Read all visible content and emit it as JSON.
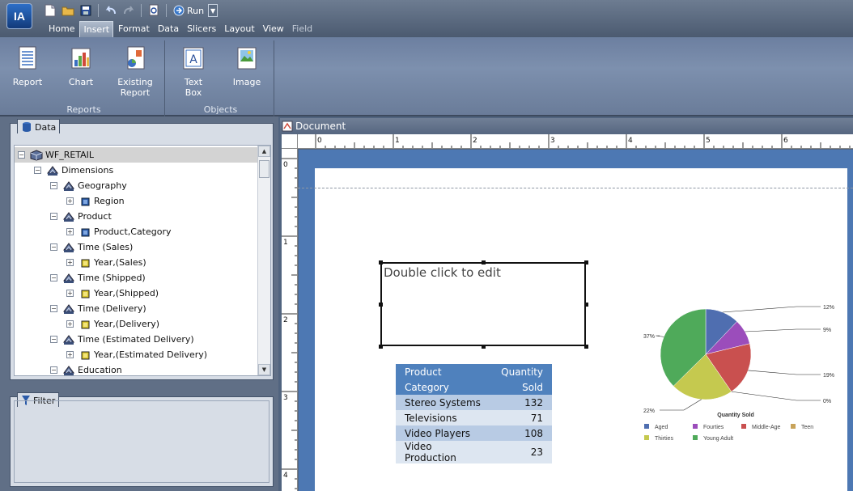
{
  "app": {
    "logo_text": "IA",
    "run_label": "Run"
  },
  "tabs": [
    {
      "label": "Home",
      "active": false,
      "enabled": true
    },
    {
      "label": "Insert",
      "active": true,
      "enabled": true
    },
    {
      "label": "Format",
      "active": false,
      "enabled": true
    },
    {
      "label": "Data",
      "active": false,
      "enabled": true
    },
    {
      "label": "Slicers",
      "active": false,
      "enabled": true
    },
    {
      "label": "Layout",
      "active": false,
      "enabled": true
    },
    {
      "label": "View",
      "active": false,
      "enabled": true
    },
    {
      "label": "Field",
      "active": false,
      "enabled": false
    }
  ],
  "ribbon": {
    "reports_group": {
      "label": "Reports",
      "report": "Report",
      "chart": "Chart",
      "existing_report_line1": "Existing",
      "existing_report_line2": "Report"
    },
    "objects_group": {
      "label": "Objects",
      "textbox_line1": "Text",
      "textbox_line2": "Box",
      "image": "Image"
    }
  },
  "data_panel": {
    "title": "Data",
    "tree": [
      {
        "label": "WF_RETAIL",
        "level": 0,
        "kind": "root",
        "expanded": true
      },
      {
        "label": "Dimensions",
        "level": 1,
        "kind": "folder",
        "expanded": true
      },
      {
        "label": "Geography",
        "level": 2,
        "kind": "folder",
        "expanded": true
      },
      {
        "label": "Region",
        "level": 3,
        "kind": "field",
        "expanded": false
      },
      {
        "label": "Product",
        "level": 2,
        "kind": "folder",
        "expanded": true
      },
      {
        "label": "Product,Category",
        "level": 3,
        "kind": "field",
        "expanded": false
      },
      {
        "label": "Time (Sales)",
        "level": 2,
        "kind": "folder",
        "expanded": true
      },
      {
        "label": "Year,(Sales)",
        "level": 3,
        "kind": "date",
        "expanded": false
      },
      {
        "label": "Time (Shipped)",
        "level": 2,
        "kind": "folder",
        "expanded": true
      },
      {
        "label": "Year,(Shipped)",
        "level": 3,
        "kind": "date",
        "expanded": false
      },
      {
        "label": "Time (Delivery)",
        "level": 2,
        "kind": "folder",
        "expanded": true
      },
      {
        "label": "Year,(Delivery)",
        "level": 3,
        "kind": "date",
        "expanded": false
      },
      {
        "label": "Time (Estimated Delivery)",
        "level": 2,
        "kind": "folder",
        "expanded": true
      },
      {
        "label": "Year,(Estimated Delivery)",
        "level": 3,
        "kind": "date",
        "expanded": false
      },
      {
        "label": "Education",
        "level": 2,
        "kind": "folder",
        "expanded": true
      }
    ]
  },
  "filter_panel": {
    "title": "Filter"
  },
  "document": {
    "title": "Document",
    "ruler_h": [
      "0",
      "1",
      "2",
      "3",
      "4",
      "5",
      "6"
    ],
    "ruler_v": [
      "0",
      "1",
      "2",
      "3",
      "4"
    ],
    "textbox_text": "Double click to edit",
    "table": {
      "headers": [
        {
          "line1": "Product",
          "line2": "Category"
        },
        {
          "line1": "Quantity",
          "line2": "Sold"
        }
      ],
      "rows": [
        {
          "category": "Stereo Systems",
          "quantity": "132"
        },
        {
          "category": "Televisions",
          "quantity": "71"
        },
        {
          "category": "Video Players",
          "quantity": "108"
        },
        {
          "category": "Video Production",
          "quantity": "23"
        }
      ]
    }
  },
  "chart_data": {
    "type": "pie",
    "title": "Quantity Sold",
    "categories": [
      "Aged",
      "Fourties",
      "Middle-Age",
      "Teen",
      "Thirties",
      "Young Adult"
    ],
    "values": [
      12,
      9,
      19,
      0,
      22,
      37
    ],
    "labels": [
      "12%",
      "9%",
      "19%",
      "0%",
      "22%",
      "37%"
    ],
    "colors": [
      "#4f6eb0",
      "#9b4dbb",
      "#c9504f",
      "#c8a35a",
      "#c5c94f",
      "#4faa5a"
    ],
    "legend_position": "bottom"
  }
}
